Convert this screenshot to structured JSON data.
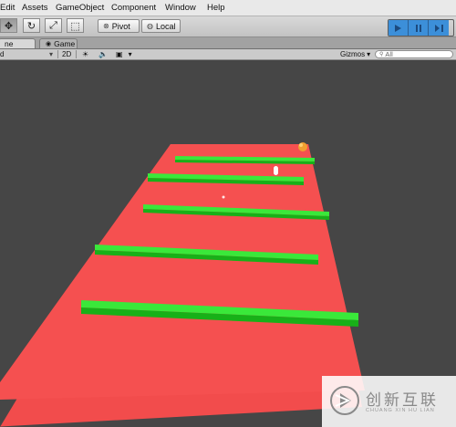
{
  "menubar": {
    "items": [
      "Edit",
      "Assets",
      "GameObject",
      "Component",
      "Window",
      "Help"
    ]
  },
  "toolbar": {
    "pivot_label": "Pivot",
    "local_label": "Local",
    "transform_tools": [
      {
        "name": "move-tool-icon",
        "glyph": "✥"
      },
      {
        "name": "rotate-tool-icon",
        "glyph": "↻"
      },
      {
        "name": "scale-tool-icon",
        "glyph": "⤢"
      },
      {
        "name": "rect-tool-icon",
        "glyph": "⬚"
      }
    ],
    "play_controls": [
      "play-button",
      "pause-button",
      "step-button"
    ]
  },
  "tabs": {
    "scene_label": "ne",
    "game_label": "Game"
  },
  "scene_options": {
    "shading_label": "d",
    "mode_2d_label": "2D",
    "gizmos_label": "Gizmos",
    "search_placeholder": "All"
  },
  "scene": {
    "floor_color": "#f24c4c",
    "wall_color": "#2fd52f",
    "sphere_color": "#f0a030",
    "player_color": "#ffffff",
    "background_color": "#464646"
  },
  "watermark": {
    "text": "创新互联",
    "subtext": "CHUANG XIN HU LIAN"
  }
}
